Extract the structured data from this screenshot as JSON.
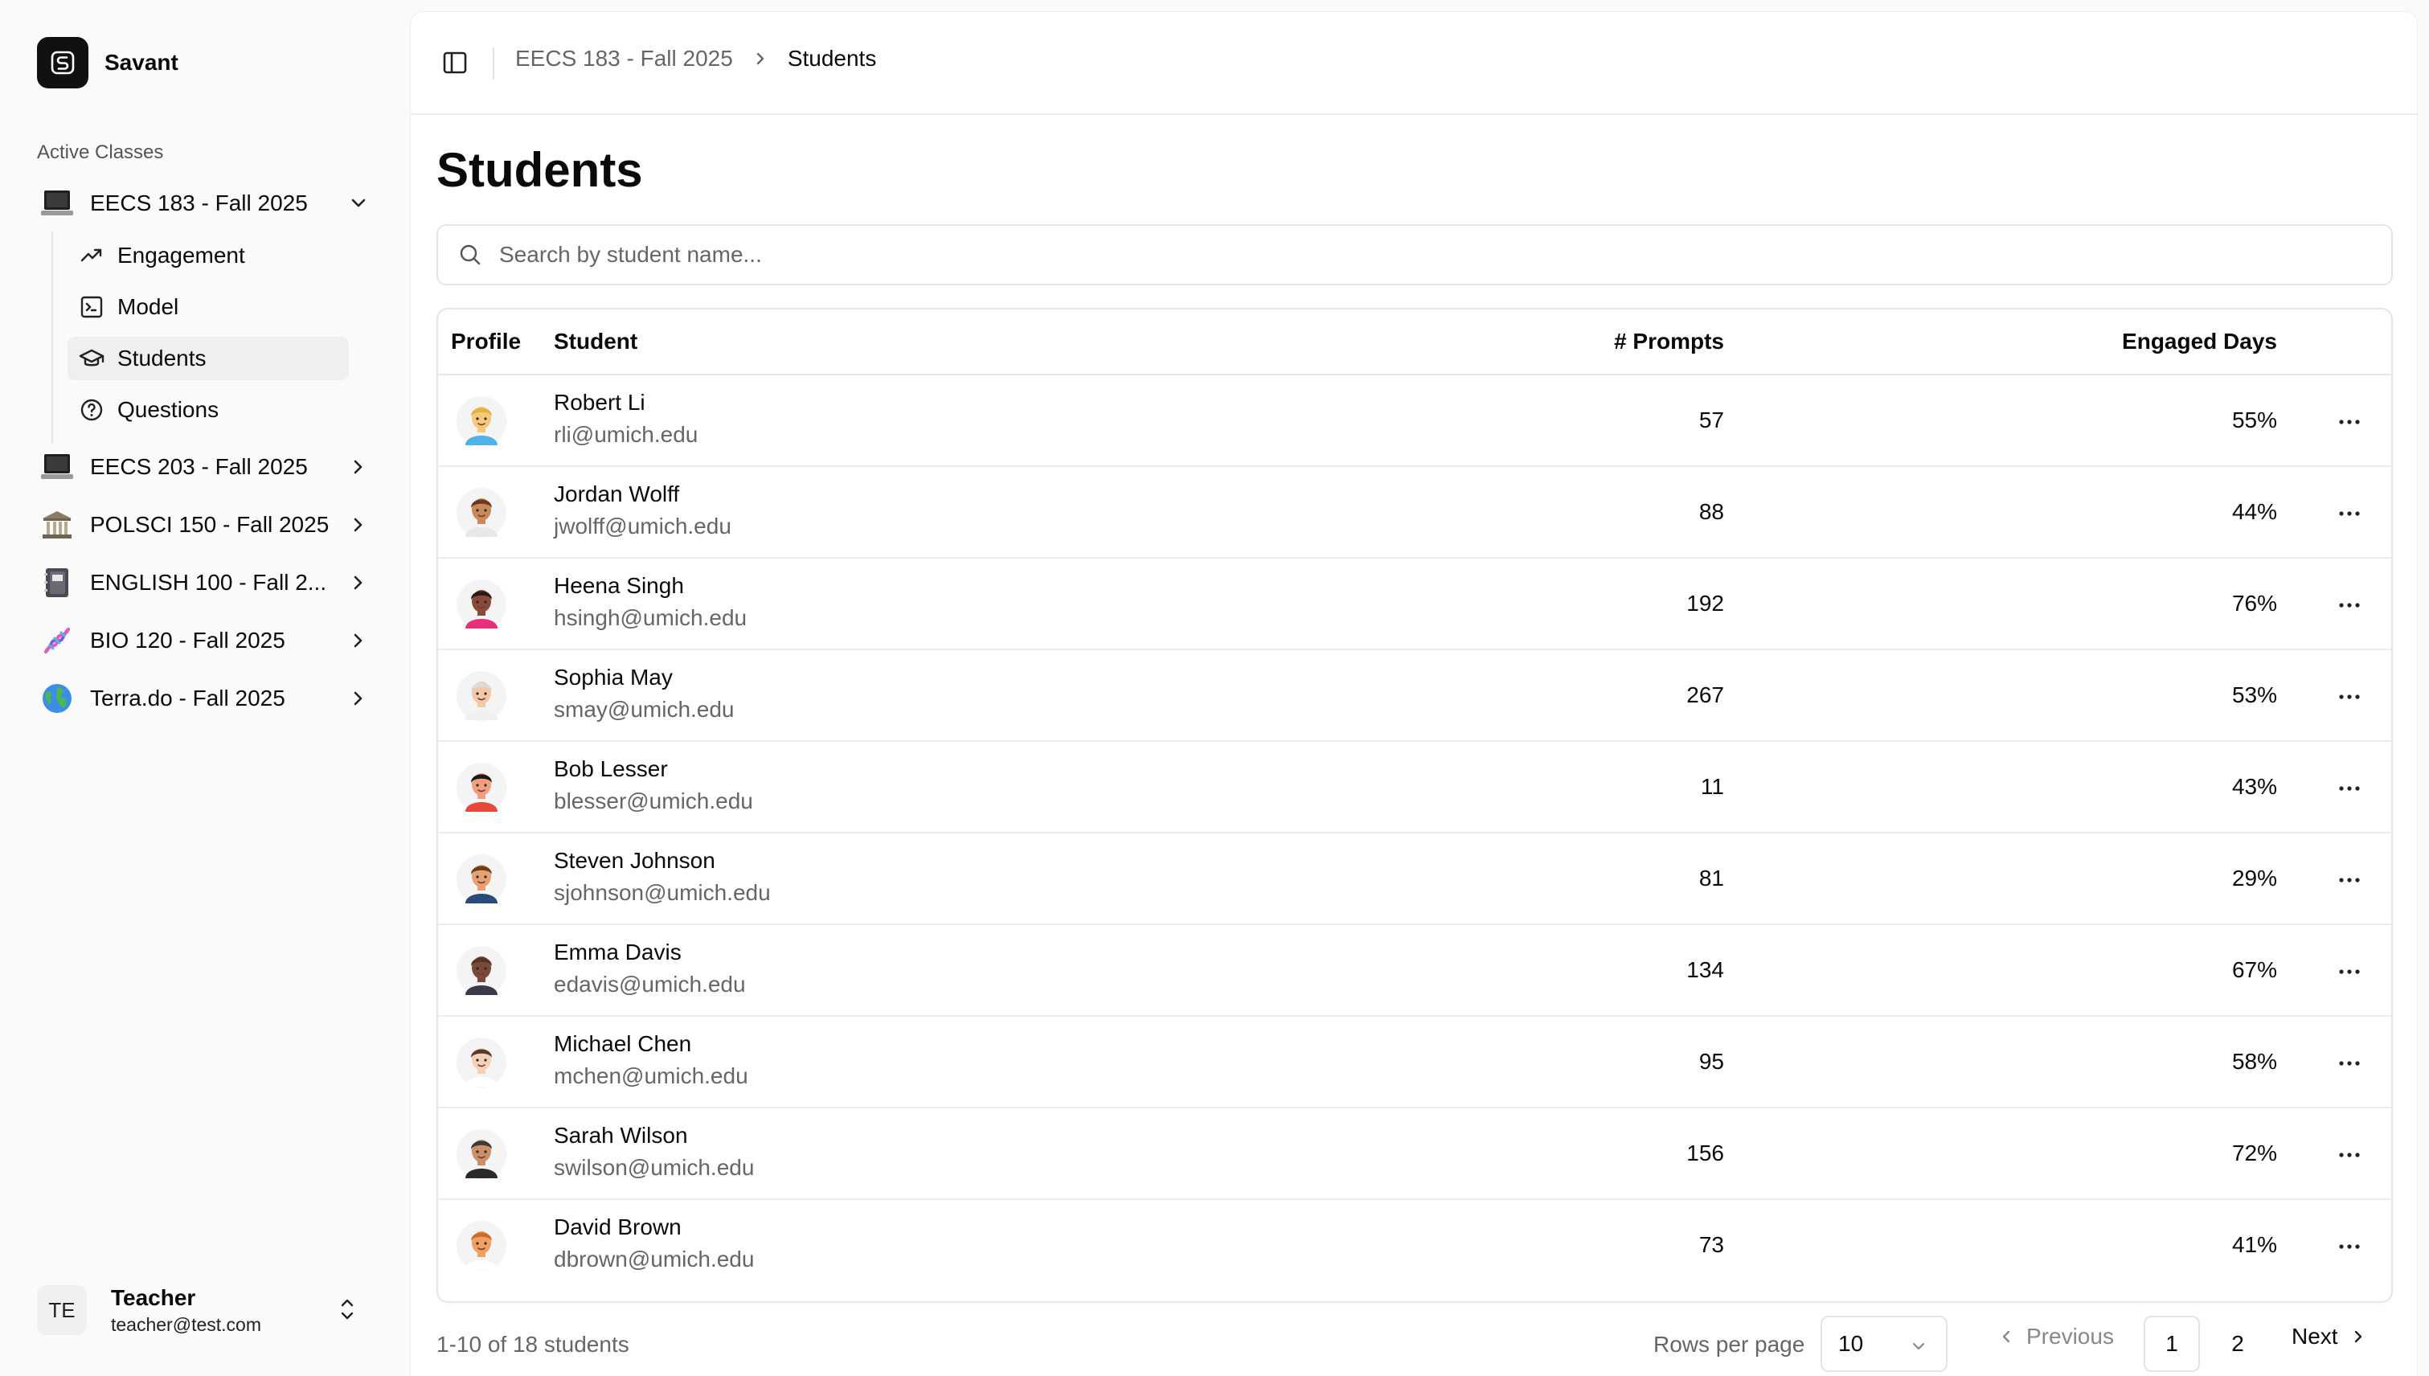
{
  "app": {
    "name": "Savant",
    "logo_icon": "savant-s-logo-icon"
  },
  "sidebar": {
    "section_label": "Active Classes",
    "classes": [
      {
        "label": "EECS 183 - Fall 2025",
        "emoji": "💻",
        "expanded": true
      },
      {
        "label": "EECS 203 - Fall 2025",
        "emoji": "💻",
        "expanded": false
      },
      {
        "label": "POLSCI 150 - Fall 2025",
        "emoji": "🏛️",
        "expanded": false
      },
      {
        "label": "ENGLISH 100 - Fall 2...",
        "emoji": "📓",
        "expanded": false
      },
      {
        "label": "BIO 120 - Fall 2025",
        "emoji": "🧬",
        "expanded": false
      },
      {
        "label": "Terra.do - Fall 2025",
        "emoji": "🌍",
        "expanded": false
      }
    ],
    "subitems": [
      {
        "label": "Engagement",
        "icon": "trending-up-icon"
      },
      {
        "label": "Model",
        "icon": "terminal-icon"
      },
      {
        "label": "Students",
        "icon": "graduation-cap-icon",
        "active": true
      },
      {
        "label": "Questions",
        "icon": "help-circle-icon"
      }
    ],
    "user": {
      "initials": "TE",
      "name": "Teacher",
      "email": "teacher@test.com"
    }
  },
  "breadcrumb": {
    "parent": "EECS 183 - Fall 2025",
    "current": "Students"
  },
  "page": {
    "title": "Students",
    "search_placeholder": "Search by student name..."
  },
  "table": {
    "columns": {
      "profile": "Profile",
      "student": "Student",
      "prompts": "# Prompts",
      "engaged": "Engaged Days"
    },
    "rows": [
      {
        "name": "Robert Li",
        "email": "rli@umich.edu",
        "prompts": "57",
        "engaged": "55%",
        "skin": "#f5c97a",
        "hair": "#e0b43c",
        "shirt": "#4fb3e8"
      },
      {
        "name": "Jordan Wolff",
        "email": "jwolff@umich.edu",
        "prompts": "88",
        "engaged": "44%",
        "skin": "#c98a5a",
        "hair": "#6b3a1e",
        "shirt": "#e8e8e8"
      },
      {
        "name": "Heena Singh",
        "email": "hsingh@umich.edu",
        "prompts": "192",
        "engaged": "76%",
        "skin": "#8a4a3a",
        "hair": "#2a1a1a",
        "shirt": "#e8307a"
      },
      {
        "name": "Sophia May",
        "email": "smay@umich.edu",
        "prompts": "267",
        "engaged": "53%",
        "skin": "#f2c9a8",
        "hair": "#dcdcdc",
        "shirt": "#f0f0f0"
      },
      {
        "name": "Bob Lesser",
        "email": "blesser@umich.edu",
        "prompts": "11",
        "engaged": "43%",
        "skin": "#f0a080",
        "hair": "#1a1a1a",
        "shirt": "#e84a3a"
      },
      {
        "name": "Steven Johnson",
        "email": "sjohnson@umich.edu",
        "prompts": "81",
        "engaged": "29%",
        "skin": "#e8a070",
        "hair": "#6b3e1e",
        "shirt": "#2a4a7a"
      },
      {
        "name": "Emma Davis",
        "email": "edavis@umich.edu",
        "prompts": "134",
        "engaged": "67%",
        "skin": "#7a4a3a",
        "hair": "#5a3226",
        "shirt": "#3a3a4a"
      },
      {
        "name": "Michael Chen",
        "email": "mchen@umich.edu",
        "prompts": "95",
        "engaged": "58%",
        "skin": "#f5d0b8",
        "hair": "#5a3a2a",
        "shirt": "#ffffff"
      },
      {
        "name": "Sarah Wilson",
        "email": "swilson@umich.edu",
        "prompts": "156",
        "engaged": "72%",
        "skin": "#c9906a",
        "hair": "#3a3a3a",
        "shirt": "#2a2a2a"
      },
      {
        "name": "David Brown",
        "email": "dbrown@umich.edu",
        "prompts": "73",
        "engaged": "41%",
        "skin": "#f0a060",
        "hair": "#d06a2a",
        "shirt": "#ffffff"
      }
    ]
  },
  "pagination": {
    "summary": "1-10 of 18 students",
    "rows_per_page_label": "Rows per page",
    "rows_per_page_value": "10",
    "previous": "Previous",
    "next": "Next",
    "pages": [
      "1",
      "2"
    ],
    "current_page": "1"
  }
}
